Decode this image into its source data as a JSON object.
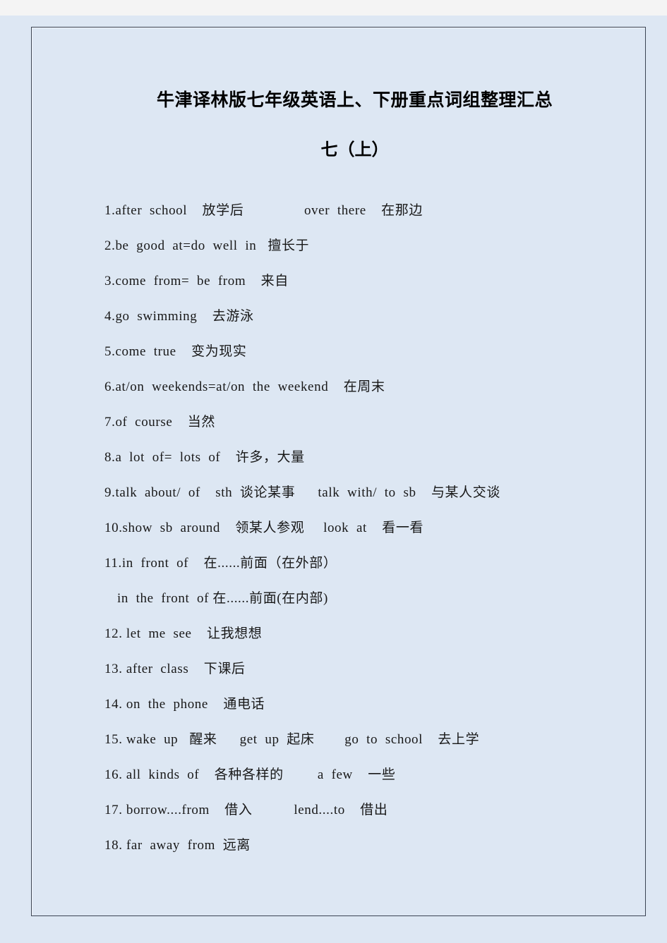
{
  "document": {
    "title": "牛津译林版七年级英语上、下册重点词组整理汇总",
    "subtitle": "七（上）",
    "colors": {
      "page_background": "#dde7f3",
      "outer_background": "#f4f4f4",
      "frame_border": "#3b4453",
      "text": "#181818"
    },
    "lines": [
      {
        "text": "1.after  school    放学后                over  there    在那边",
        "indented": false
      },
      {
        "text": "2.be  good  at=do  well  in   擅长于",
        "indented": false
      },
      {
        "text": "3.come  from=  be  from    来自",
        "indented": false
      },
      {
        "text": "4.go  swimming    去游泳",
        "indented": false
      },
      {
        "text": "5.come  true    变为现实",
        "indented": false
      },
      {
        "text": "6.at/on  weekends=at/on  the  weekend    在周末",
        "indented": false
      },
      {
        "text": "7.of  course    当然",
        "indented": false
      },
      {
        "text": "8.a  lot  of=  lots  of    许多，大量",
        "indented": false
      },
      {
        "text": "9.talk  about/  of    sth  谈论某事      talk  with/  to  sb    与某人交谈",
        "indented": false
      },
      {
        "text": "10.show  sb  around    领某人参观     look  at    看一看",
        "indented": false
      },
      {
        "text": "11.in  front  of    在......前面（在外部）",
        "indented": false
      },
      {
        "text": "in  the  front  of 在......前面(在内部)",
        "indented": true
      },
      {
        "text": "12. let  me  see    让我想想",
        "indented": false
      },
      {
        "text": "13. after  class    下课后",
        "indented": false
      },
      {
        "text": "14. on  the  phone    通电话",
        "indented": false
      },
      {
        "text": "15. wake  up   醒来      get  up  起床        go  to  school    去上学",
        "indented": false
      },
      {
        "text": "16. all  kinds  of    各种各样的         a  few    一些",
        "indented": false
      },
      {
        "text": "17. borrow....from    借入           lend....to    借出",
        "indented": false
      },
      {
        "text": "18. far  away  from  远离",
        "indented": false
      }
    ]
  }
}
